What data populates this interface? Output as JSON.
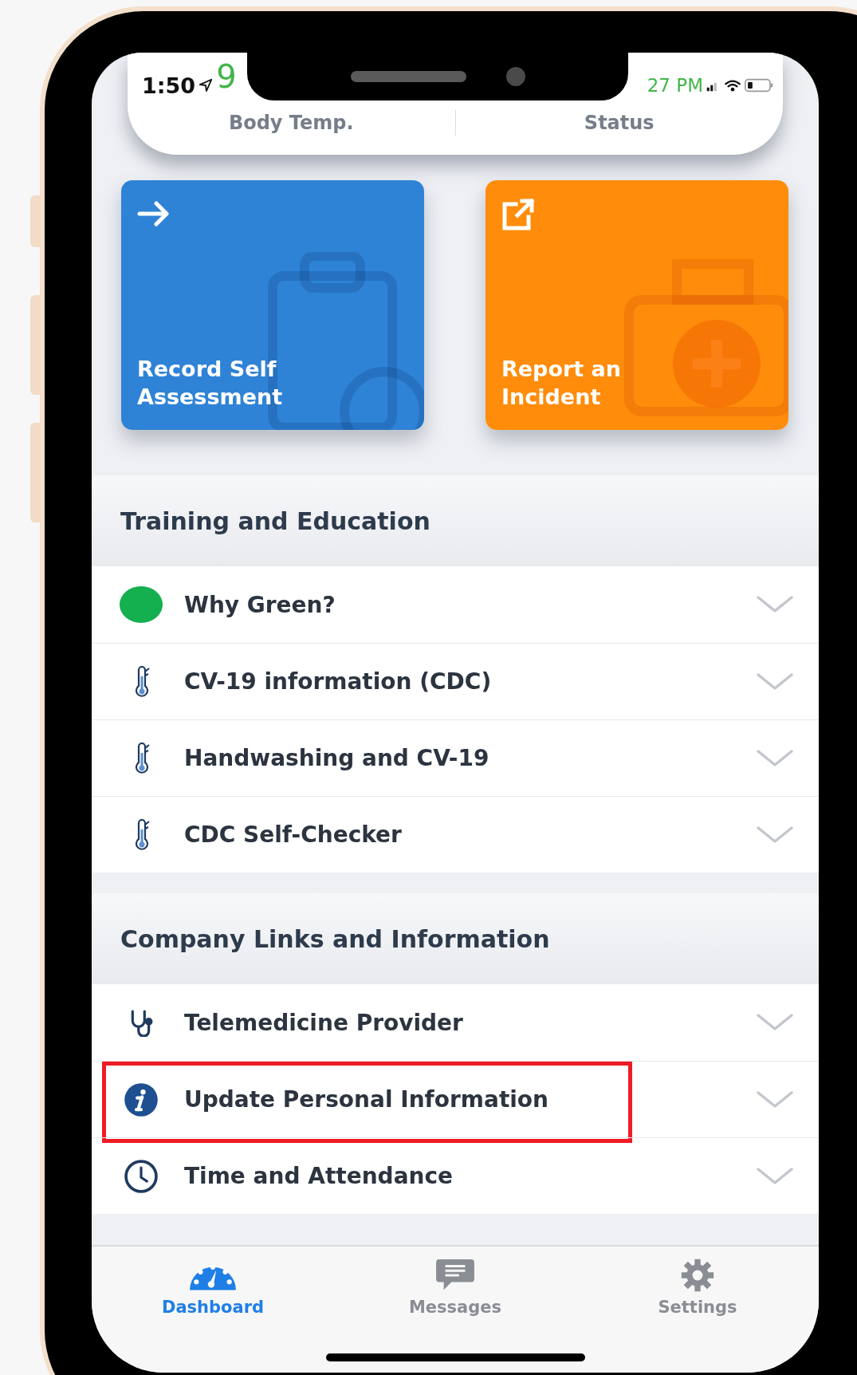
{
  "status_bar": {
    "time": "1:50",
    "ghost_texts": [
      "9",
      "27 PM"
    ]
  },
  "stats": [
    {
      "label": "Body Temp."
    },
    {
      "label": "Status"
    }
  ],
  "tiles": [
    {
      "kind": "arrow",
      "label": "Record Self Assessment",
      "color": "#2f83d6"
    },
    {
      "kind": "external",
      "label": "Report an Incident",
      "color": "#ff8c0a"
    }
  ],
  "sections": [
    {
      "title": "Training and Education",
      "rows": [
        {
          "kind": "dot",
          "color": "#14b04f",
          "label": "Why Green?",
          "expanded": false,
          "highlighted": false
        },
        {
          "kind": "thermometer",
          "label": "CV-19 information (CDC)",
          "expanded": false,
          "highlighted": false
        },
        {
          "kind": "thermometer",
          "label": "Handwashing and CV-19",
          "expanded": false,
          "highlighted": false
        },
        {
          "kind": "thermometer",
          "label": "CDC Self-Checker",
          "expanded": false,
          "highlighted": false
        }
      ]
    },
    {
      "title": "Company Links and Information",
      "rows": [
        {
          "kind": "stethoscope",
          "label": "Telemedicine Provider",
          "expanded": false,
          "highlighted": false
        },
        {
          "kind": "info",
          "label": "Update Personal Information",
          "expanded": false,
          "highlighted": true
        },
        {
          "kind": "clock",
          "label": "Time and Attendance",
          "expanded": false,
          "highlighted": false
        }
      ]
    }
  ],
  "tab_bar": [
    {
      "kind": "dashboard",
      "label": "Dashboard",
      "selected": true
    },
    {
      "kind": "messages",
      "label": "Messages",
      "selected": false
    },
    {
      "kind": "settings",
      "label": "Settings",
      "selected": false
    }
  ]
}
